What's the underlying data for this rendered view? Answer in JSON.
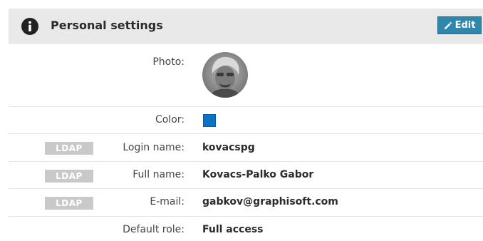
{
  "header": {
    "title": "Personal settings",
    "edit_label": "Edit",
    "icon": "info-icon"
  },
  "rows": {
    "photo": {
      "label": "Photo:"
    },
    "color": {
      "label": "Color:",
      "value": "#0a73c8"
    },
    "login": {
      "badge": "LDAP",
      "label": "Login name:",
      "value": "kovacspg"
    },
    "fullname": {
      "badge": "LDAP",
      "label": "Full name:",
      "value": "Kovacs-Palko Gabor"
    },
    "email": {
      "badge": "LDAP",
      "label": "E-mail:",
      "value": "gabkov@graphisoft.com"
    },
    "role": {
      "label": "Default role:",
      "value": "Full access"
    }
  },
  "colors": {
    "accent": "#2e88ad",
    "header_bg": "#e9e9e9",
    "badge_bg": "#c9c9c9",
    "user_color": "#0a73c8"
  }
}
